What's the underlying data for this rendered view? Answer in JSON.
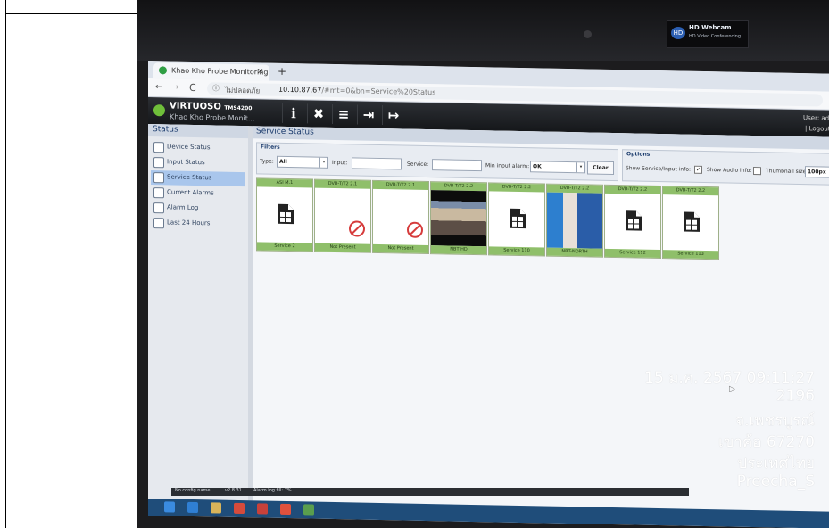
{
  "browser": {
    "tab_title": "Khao Kho Probe Monitoring",
    "tab_close": "×",
    "new_tab": "+",
    "back": "←",
    "forward": "→",
    "reload": "C",
    "info_icon": "ⓘ",
    "security_label": "ไม่ปลอดภัย",
    "url_host": "10.10.87.67",
    "url_path": "/#mt=0&bn=Service%20Status"
  },
  "app": {
    "product": "VIRTUOSO",
    "model": "TMS4200",
    "probe_name": "Khao Kho Probe Monit...",
    "user_label": "User: ad",
    "logout_label": "| Logout",
    "toolbar_icons": [
      "info-icon",
      "tools-icon",
      "server-icon",
      "login-icon",
      "logout-icon"
    ],
    "toolbar_glyphs": [
      "ℹ",
      "✖",
      "≡",
      "⇥",
      "↦"
    ]
  },
  "sidebar": {
    "title": "Status",
    "items": [
      {
        "label": "Device Status",
        "icon": "device-icon",
        "active": false
      },
      {
        "label": "Input Status",
        "icon": "input-icon",
        "active": false
      },
      {
        "label": "Service Status",
        "icon": "monitor-icon",
        "active": true
      },
      {
        "label": "Current Alarms",
        "icon": "alarm-icon",
        "active": false
      },
      {
        "label": "Alarm Log",
        "icon": "log-icon",
        "active": false
      },
      {
        "label": "Last 24 Hours",
        "icon": "history-icon",
        "active": false
      }
    ]
  },
  "main": {
    "title": "Service Status",
    "filters": {
      "title": "Filters",
      "type_label": "Type:",
      "type_value": "All",
      "input_label": "Input:",
      "input_value": "",
      "service_label": "Service:",
      "service_value": "",
      "min_alarm_label": "Min input alarm:",
      "min_alarm_value": "OK",
      "clear_label": "Clear"
    },
    "options": {
      "title": "Options",
      "show_service_label": "Show Service/Input info:",
      "show_service_checked": true,
      "show_audio_label": "Show Audio info:",
      "show_audio_checked": false,
      "thumb_size_label": "Thumbnail size:",
      "thumb_size_value": "100px"
    },
    "tiles": [
      {
        "input": "ASI M.1",
        "service": "Service 2",
        "state": "doc"
      },
      {
        "input": "DVB-T/T2 2.1",
        "service": "Not Present",
        "state": "absent"
      },
      {
        "input": "DVB-T/T2 2.1",
        "service": "Not Present",
        "state": "absent"
      },
      {
        "input": "DVB-T/T2 2.2",
        "service": "NBT HD",
        "state": "video-crowd"
      },
      {
        "input": "DVB-T/T2 2.2",
        "service": "Service 110",
        "state": "doc"
      },
      {
        "input": "DVB-T/T2 2.2",
        "service": "NBT-NORTH",
        "state": "video-anchor"
      },
      {
        "input": "DVB-T/T2 2.2",
        "service": "Service 112",
        "state": "doc"
      },
      {
        "input": "DVB-T/T2 2.2",
        "service": "Service 113",
        "state": "doc"
      }
    ]
  },
  "status_strip": {
    "config": "No config name",
    "version": "v2.8.31",
    "alarm_log": "Alarm log fill: 7%"
  },
  "webcam": {
    "title": "HD Webcam",
    "subtitle": "HD Video Conferencing"
  },
  "overlay": {
    "datetime": "15 ม.ค. 2567 09:11:27",
    "altitude": "2196",
    "province": "จ.เพชรบูรณ์",
    "district": "เขาค้อ 67270",
    "country": "ประเทศไทย",
    "author": "Preecha_S"
  },
  "colors": {
    "tile_green": "#8fbf6a",
    "no_entry_red": "#d63b3b",
    "active_item": "#a9c6ec",
    "header_dark": "#15171a"
  }
}
